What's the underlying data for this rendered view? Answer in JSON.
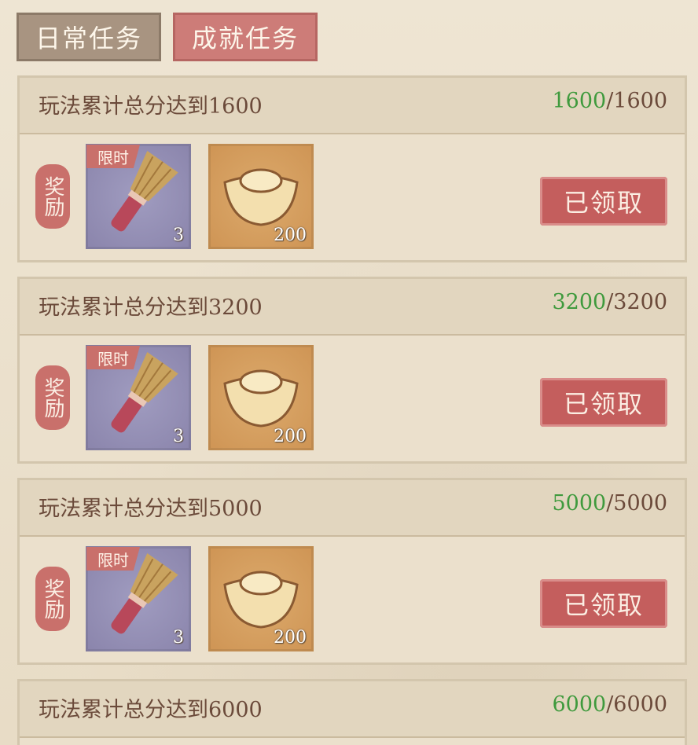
{
  "tabs": {
    "daily": "日常任务",
    "achievement": "成就任务"
  },
  "reward_label": "奖励",
  "limited_label": "限时",
  "tasks": [
    {
      "title": "玩法累计总分达到1600",
      "current": "1600",
      "total": "/1600",
      "items": [
        {
          "icon": "brush-icon",
          "qty": "3"
        },
        {
          "icon": "gold-ingot-icon",
          "qty": "200"
        }
      ],
      "status": "已领取"
    },
    {
      "title": "玩法累计总分达到3200",
      "current": "3200",
      "total": "/3200",
      "items": [
        {
          "icon": "brush-icon",
          "qty": "3"
        },
        {
          "icon": "gold-ingot-icon",
          "qty": "200"
        }
      ],
      "status": "已领取"
    },
    {
      "title": "玩法累计总分达到5000",
      "current": "5000",
      "total": "/5000",
      "items": [
        {
          "icon": "brush-icon",
          "qty": "3"
        },
        {
          "icon": "gold-ingot-icon",
          "qty": "200"
        }
      ],
      "status": "已领取"
    },
    {
      "title": "玩法累计总分达到6000",
      "current": "6000",
      "total": "/6000"
    }
  ],
  "colors": {
    "accent_red": "#c45e5d",
    "progress_green": "#3f9a3d",
    "text_brown": "#6b4a3a"
  }
}
